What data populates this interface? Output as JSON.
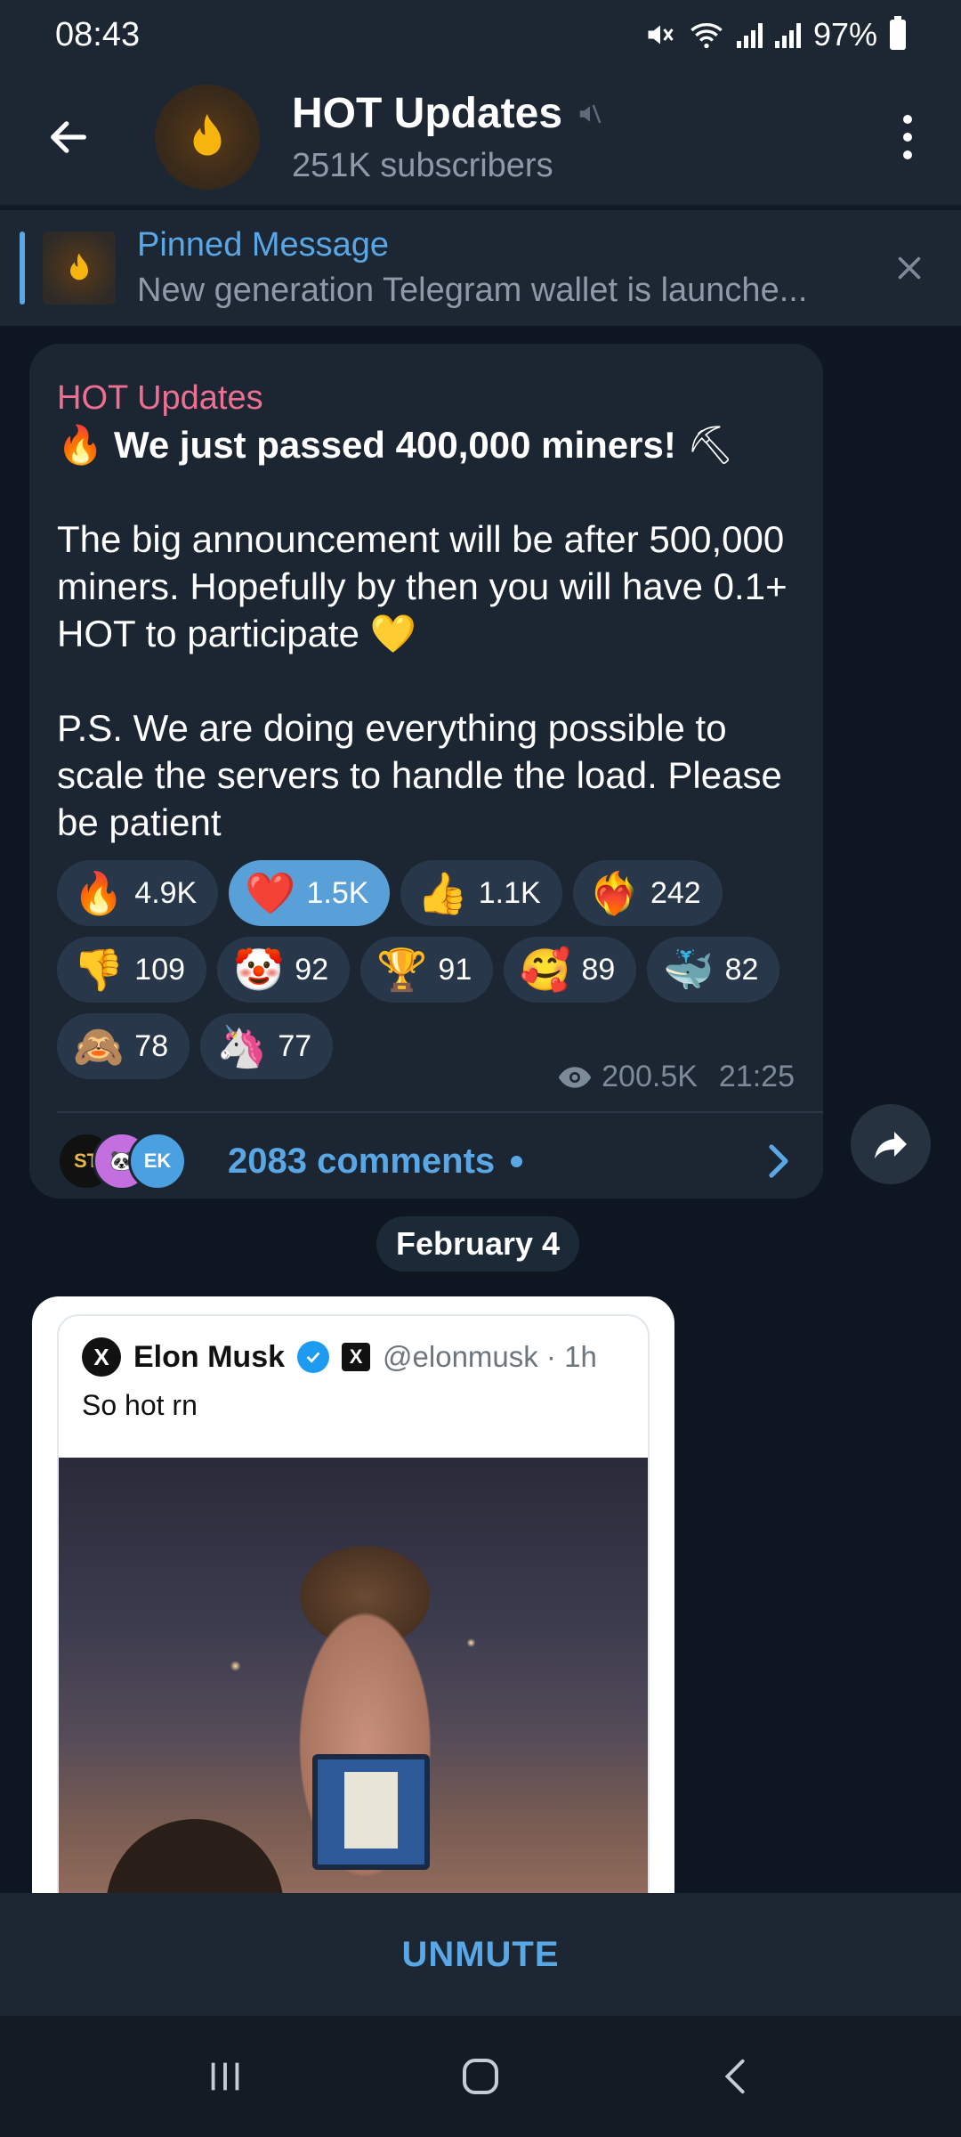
{
  "status": {
    "time": "08:43",
    "battery": "97%"
  },
  "header": {
    "title": "HOT Updates",
    "subtitle": "251K subscribers"
  },
  "pinned": {
    "label": "Pinned Message",
    "preview": "New generation Telegram wallet is launche..."
  },
  "post": {
    "author": "HOT Updates",
    "headline": "We just passed 400,000 miners!",
    "paragraph1": "The big announcement will be after 500,000 miners. Hopefully by then you will have 0.1+ HOT to participate",
    "paragraph2": "P.S. We are doing everything possible to scale the servers to handle the load. Please be patient",
    "reactions": [
      {
        "emoji": "🔥",
        "count": "4.9K",
        "active": false
      },
      {
        "emoji": "❤️",
        "count": "1.5K",
        "active": true
      },
      {
        "emoji": "👍",
        "count": "1.1K",
        "active": false
      },
      {
        "emoji": "❤️‍🔥",
        "count": "242",
        "active": false
      },
      {
        "emoji": "👎",
        "count": "109",
        "active": false
      },
      {
        "emoji": "🤡",
        "count": "92",
        "active": false
      },
      {
        "emoji": "🏆",
        "count": "91",
        "active": false
      },
      {
        "emoji": "🥰",
        "count": "89",
        "active": false
      },
      {
        "emoji": "🐳",
        "count": "82",
        "active": false
      },
      {
        "emoji": "🙈",
        "count": "78",
        "active": false
      },
      {
        "emoji": "🦄",
        "count": "77",
        "active": false
      }
    ],
    "views": "200.5K",
    "time": "21:25",
    "comments": "2083 comments",
    "commenter_avatars": [
      "ST",
      "🐼",
      "EK"
    ]
  },
  "date_separator": "February 4",
  "tweet": {
    "name": "Elon Musk",
    "handle": "@elonmusk · 1h",
    "text": "So hot rn"
  },
  "bottom": {
    "unmute_label": "UNMUTE"
  },
  "colors": {
    "accent": "#5aa7e6",
    "author": "#ed6f91",
    "bubble": "#1c2633"
  }
}
